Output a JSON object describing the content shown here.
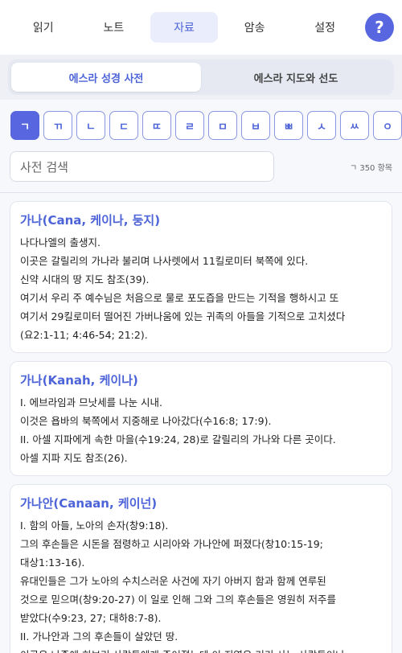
{
  "topnav": {
    "tabs": [
      {
        "label": "읽기"
      },
      {
        "label": "노트"
      },
      {
        "label": "자료"
      },
      {
        "label": "암송"
      },
      {
        "label": "설정"
      }
    ],
    "help_label": "?"
  },
  "segment": {
    "left": "에스라 성경 사전",
    "right": "에스라 지도와 선도"
  },
  "consonants": [
    "ㄱ",
    "ㄲ",
    "ㄴ",
    "ㄷ",
    "ㄸ",
    "ㄹ",
    "ㅁ",
    "ㅂ",
    "ㅃ",
    "ㅅ",
    "ㅆ",
    "ㅇ"
  ],
  "search": {
    "placeholder": "사전 검색",
    "count": "ㄱ 350 항목"
  },
  "entries": [
    {
      "title": "가나(Cana, 케이나, 둥지)",
      "lines": [
        "나다나엘의 출생지.",
        "이곳은 갈릴리의 가나라 불리며 나사렛에서 11킬로미터 북쪽에 있다.",
        "신약 시대의 땅 지도 참조(39).",
        "여기서 우리 주 예수님은 처음으로 물로 포도즙을 만드는 기적을 행하시고 또",
        "여기서 29킬로미터 떨어진 가버나움에 있는 귀족의 아들을 기적으로 고치셨다",
        "(요2:1-11; 4:46-54; 21:2)."
      ]
    },
    {
      "title": "가나(Kanah, 케이나)",
      "lines": [
        "I. 에브라임과 므낫세를 나눈 시내.",
        "이것은 욥바의 북쪽에서 지중해로 나아갔다(수16:8; 17:9).",
        "II. 아셀 지파에게 속한 마을(수19:24, 28)로 갈릴리의 가나와 다른 곳이다.",
        "아셀 지파 지도 참조(26)."
      ]
    },
    {
      "title": "가나안(Canaan, 케이넌)",
      "lines": [
        "I. 함의 아들, 노아의 손자(창9:18).",
        "그의 후손들은 시돈을 점령하고 시리아와 가나안에 퍼졌다(창10:15-19;",
        "대상1:13-16).",
        "유대인들은 그가 노아의 수치스러운 사건에 자기 아버지 함과 함께 연루된",
        "것으로 믿으며(창9:20-27) 이 일로 인해 그와 그의 후손들은 영원히 저주를",
        "받았다(수9:23, 27; 대하8:7-8).",
        "II. 가나안과 그의 후손들이 살았던 땅.",
        "이곳은 나중에 히브리 사람들에게 주어졌는데 이 지역은 거기 사는 사람들이나"
      ]
    }
  ]
}
